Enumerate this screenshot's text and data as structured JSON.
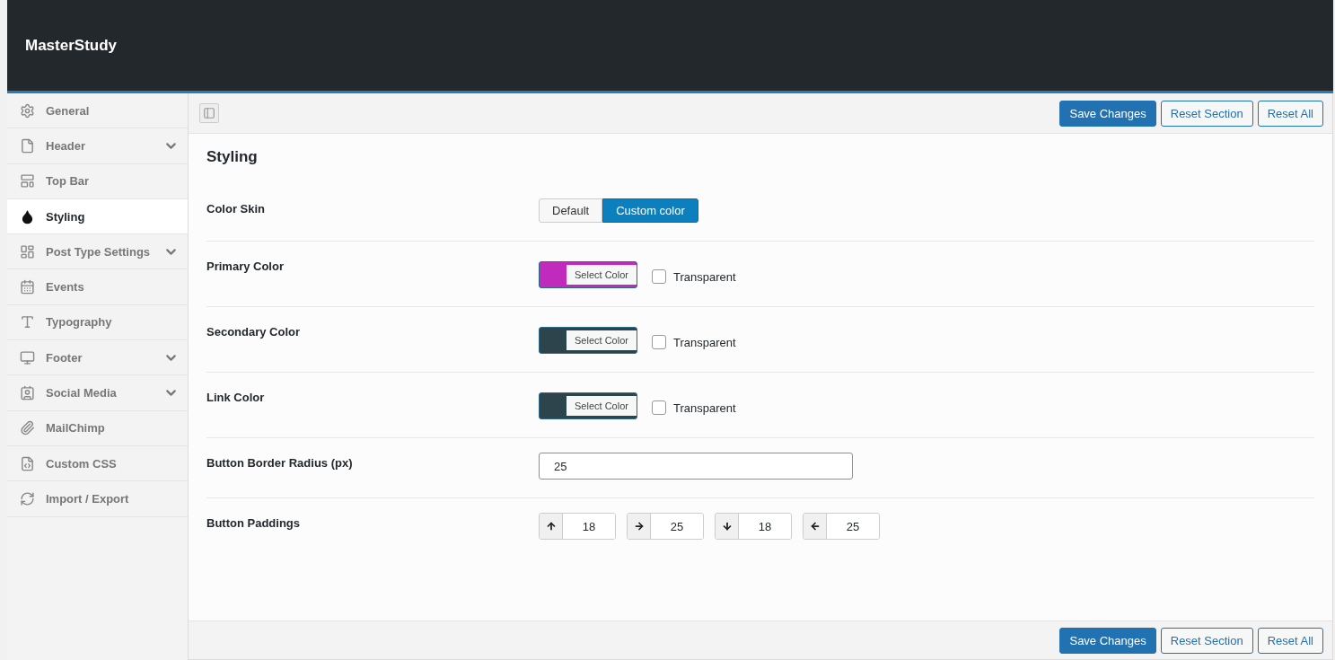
{
  "app_title": "MasterStudy",
  "sidebar": {
    "items": [
      {
        "label": "General",
        "selected": false,
        "expandable": false
      },
      {
        "label": "Header",
        "selected": false,
        "expandable": true
      },
      {
        "label": "Top Bar",
        "selected": false,
        "expandable": false
      },
      {
        "label": "Styling",
        "selected": true,
        "expandable": false
      },
      {
        "label": "Post Type Settings",
        "selected": false,
        "expandable": true
      },
      {
        "label": "Events",
        "selected": false,
        "expandable": false
      },
      {
        "label": "Typography",
        "selected": false,
        "expandable": false
      },
      {
        "label": "Footer",
        "selected": false,
        "expandable": true
      },
      {
        "label": "Social Media",
        "selected": false,
        "expandable": true
      },
      {
        "label": "MailChimp",
        "selected": false,
        "expandable": false
      },
      {
        "label": "Custom CSS",
        "selected": false,
        "expandable": false
      },
      {
        "label": "Import / Export",
        "selected": false,
        "expandable": false
      }
    ]
  },
  "top_actions": [
    "Save Changes",
    "Reset Section",
    "Reset All"
  ],
  "section_title": "Styling",
  "fields": [
    {
      "kind": "buttonset",
      "label": "Color Skin",
      "options": [
        {
          "label": "Default",
          "selected": false
        },
        {
          "label": "Custom color",
          "selected": true
        }
      ]
    },
    {
      "kind": "color",
      "label": "Primary Color",
      "color": "#c02bbd",
      "button": "Select Color",
      "transparent_label": "Transparent",
      "checked": false
    },
    {
      "kind": "color",
      "label": "Secondary Color",
      "color": "#2d444c",
      "button": "Select Color",
      "transparent_label": "Transparent",
      "checked": false
    },
    {
      "kind": "color",
      "label": "Link Color",
      "color": "#2d444c",
      "button": "Select Color",
      "transparent_label": "Transparent",
      "checked": false
    },
    {
      "kind": "text",
      "label": "Button Border Radius (px)",
      "value": "25"
    },
    {
      "kind": "paddings",
      "label": "Button Paddings",
      "values": [
        "18",
        "25",
        "18",
        "25"
      ]
    }
  ],
  "bottom_actions": [
    "Save Changes",
    "Reset Section",
    "Reset All"
  ]
}
